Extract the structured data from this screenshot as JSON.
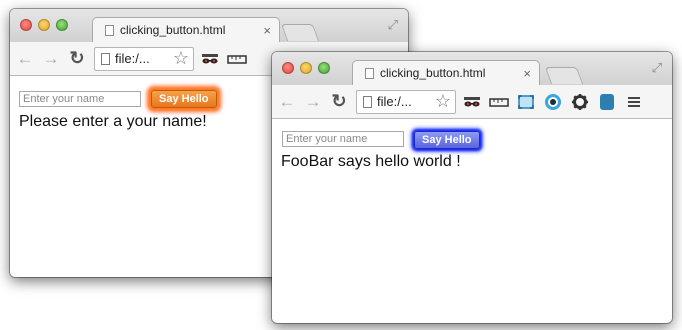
{
  "windows": [
    {
      "tab_title": "clicking_button.html",
      "address": "file:/...",
      "input_placeholder": "Enter your name",
      "button_label": "Say Hello",
      "message": "Please enter a your name!",
      "button_glow_color": "#ff7a1a"
    },
    {
      "tab_title": "clicking_button.html",
      "address": "file:/...",
      "input_placeholder": "Enter your name",
      "button_label": "Say Hello",
      "message": "FooBar says hello world !",
      "button_glow_color": "#1a2bff"
    }
  ],
  "icons": {
    "tab_close": "×",
    "back": "←",
    "forward": "→",
    "reload": "↻",
    "star": "☆",
    "fullscreen": "⤢"
  }
}
